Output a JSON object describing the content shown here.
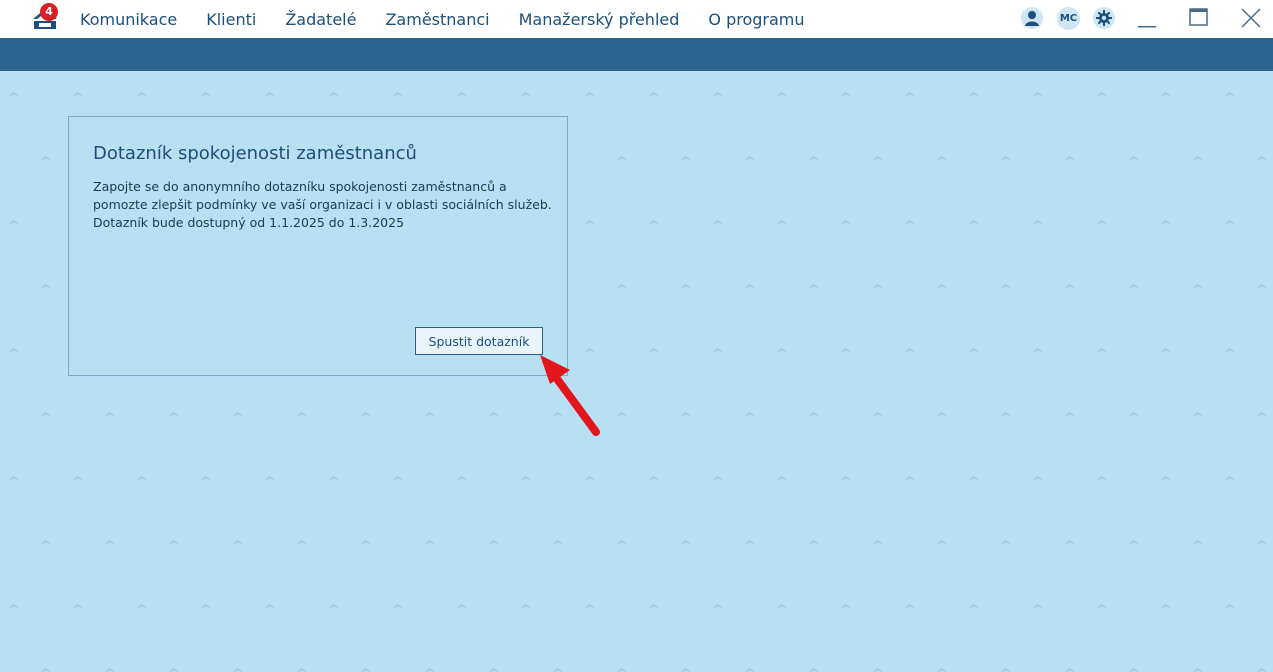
{
  "app": {
    "notification_count": "4",
    "user_initials": "MC"
  },
  "menu": {
    "items": [
      {
        "label": "Komunikace"
      },
      {
        "label": "Klienti"
      },
      {
        "label": "Žadatelé"
      },
      {
        "label": "Zaměstnanci"
      },
      {
        "label": "Manažerský přehled"
      },
      {
        "label": "O programu"
      }
    ]
  },
  "icons": {
    "right": [
      "user-icon",
      "initials-avatar",
      "gear-icon",
      "minimize-icon",
      "maximize-icon",
      "close-icon"
    ]
  },
  "card": {
    "title": "Dotazník spokojenosti zaměstnanců",
    "text_lines": [
      "Zapojte se do anonymního dotazníku spokojenosti zaměstnanců a",
      "pomozte zlepšit podmínky ve vaší organizaci i v oblasti sociálních služeb.",
      "Dotazník bude dostupný od 1.1.2025 do 1.3.2025"
    ],
    "button_label": "Spustit dotazník"
  },
  "colors": {
    "accent": "#2b6490",
    "background": "#b8dff2",
    "text": "#1d4f7c",
    "badge": "#d71f26",
    "annotation_arrow": "#e3161b"
  }
}
